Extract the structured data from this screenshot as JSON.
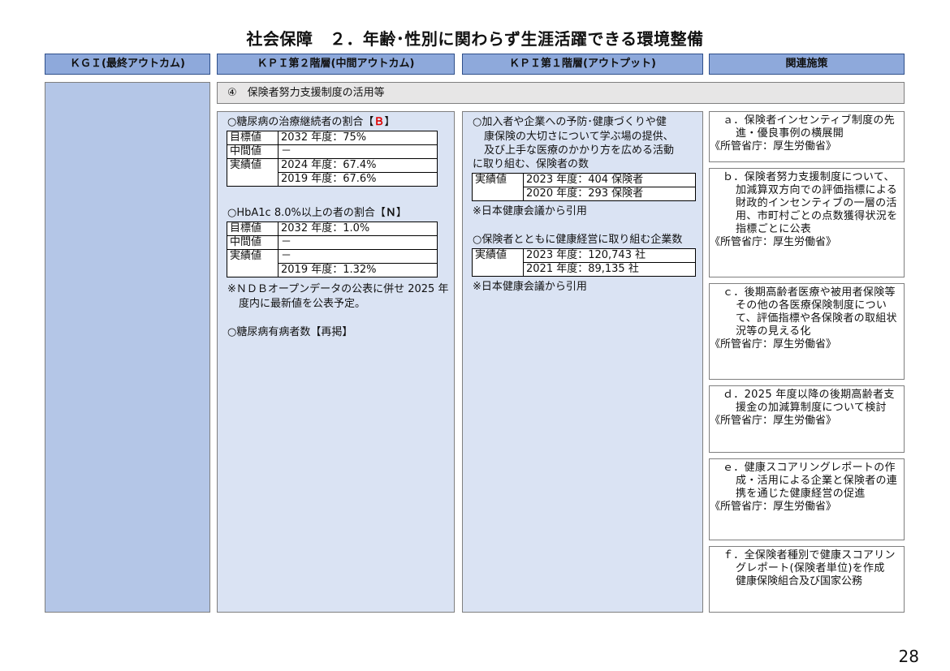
{
  "title": "社会保障　２．年齢･性別に関わらず生涯活躍できる環境整備",
  "headers": {
    "kgi": "ＫＧＩ(最終アウトカム)",
    "kpi2": "ＫＰＩ第２階層(中間アウトカム)",
    "kpi1": "ＫＰＩ第１階層(アウトプット)",
    "measures": "関連施策"
  },
  "section": "④　保険者努力支援制度の活用等",
  "kpi2": {
    "item1_title": "○糖尿病の治療継続者の割合【",
    "item1_grade": "Ｂ",
    "item1_close": "】",
    "item1_rows": [
      {
        "label": "目標値",
        "value": "2032 年度：75%"
      },
      {
        "label": "中間値",
        "value": "－"
      },
      {
        "label": "実績値",
        "value": "2024 年度：67.4%"
      },
      {
        "label": "",
        "value": "2019 年度：67.6%"
      }
    ],
    "item2_title": "○HbA1c 8.0%以上の者の割合【",
    "item2_grade": "Ｎ",
    "item2_close": "】",
    "item2_rows": [
      {
        "label": "目標値",
        "value": "2032 年度：1.0%"
      },
      {
        "label": "中間値",
        "value": "－"
      },
      {
        "label": "実績値",
        "value": "－"
      },
      {
        "label": "",
        "value": "2019 年度：1.32%"
      }
    ],
    "note1_line1": "※ＮＤＢオープンデータの公表に併せ 2025 年",
    "note1_line2": "度内に最新値を公表予定。",
    "item3_title": "○糖尿病有病者数【再掲】"
  },
  "kpi1": {
    "item1_lines": [
      "○加入者や企業への予防･健康づくりや健",
      "康保険の大切さについて学ぶ場の提供、",
      "及び上手な医療のかかり方を広める活動",
      "に取り組む、保険者の数"
    ],
    "item1_rows": [
      {
        "label": "実績値",
        "value": "2023 年度：404 保険者"
      },
      {
        "label": "",
        "value": "2020 年度：293 保険者"
      }
    ],
    "item1_note": "※日本健康会議から引用",
    "item2_title": "○保険者とともに健康経営に取り組む企業数",
    "item2_rows": [
      {
        "label": "実績値",
        "value": "2023 年度：120,743 社"
      },
      {
        "label": "",
        "value": "2021 年度：89,135 社"
      }
    ],
    "item2_note": "※日本健康会議から引用"
  },
  "measures": [
    {
      "text": "ａ．保険者インセンティブ制度の先進・優良事例の横展開",
      "ministry": "《所管省庁：厚生労働省》"
    },
    {
      "text": "ｂ．保険者努力支援制度について、加減算双方向での評価指標による財政的インセンティブの一層の活用、市町村ごとの点数獲得状況を指標ごとに公表",
      "ministry": "《所管省庁：厚生労働省》"
    },
    {
      "text": "ｃ．後期高齢者医療や被用者保険等その他の各医療保険制度について、評価指標や各保険者の取組状況等の見える化",
      "ministry": "《所管省庁：厚生労働省》"
    },
    {
      "text": "ｄ．2025 年度以降の後期高齢者支援金の加減算制度について検討",
      "ministry": "《所管省庁：厚生労働省》"
    },
    {
      "text": "ｅ．健康スコアリングレポートの作成・活用による企業と保険者の連携を通じた健康経営の促進",
      "ministry": "《所管省庁：厚生労働省》"
    },
    {
      "text": "ｆ．全保険者種別で健康スコアリングレポート(保険者単位)を作成",
      "extra": "健康保険組合及び国家公務"
    }
  ],
  "page_number": "28"
}
